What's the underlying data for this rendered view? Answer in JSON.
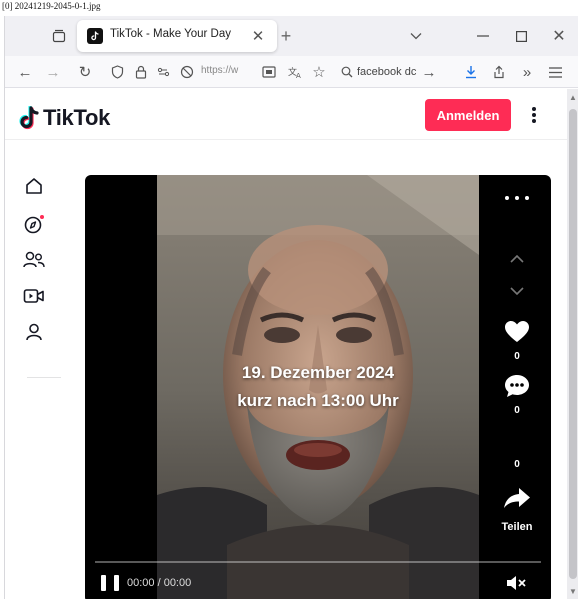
{
  "screenshot": {
    "file_label": "[0] 20241219-2045-0-1.jpg"
  },
  "browser": {
    "tab": {
      "title": "TikTok - Make Your Day"
    },
    "address": {
      "url_text": "https://w"
    },
    "search": {
      "text": "facebook dc"
    }
  },
  "tiktok": {
    "logo_text": "TikTok",
    "login_label": "Anmelden",
    "sidenav": {
      "items": [
        {
          "icon": "home-icon",
          "label": "For You"
        },
        {
          "icon": "explore-icon",
          "label": "Explore",
          "badge": true
        },
        {
          "icon": "following-icon",
          "label": "Following"
        },
        {
          "icon": "live-icon",
          "label": "LIVE"
        },
        {
          "icon": "profile-icon",
          "label": "Profile"
        }
      ]
    },
    "video": {
      "overlay_line1": "19. Dezember 2024",
      "overlay_line2": "kurz nach 13:00 Uhr",
      "like_count": "0",
      "comment_count": "0",
      "save_count": "0",
      "share_label": "Teilen",
      "time_text": "00:00 / 00:00",
      "progress": 0
    }
  },
  "colors": {
    "brand": "#fe2c55",
    "video_bg": "#000000",
    "tab_bar_bg": "#f0f0f4"
  }
}
